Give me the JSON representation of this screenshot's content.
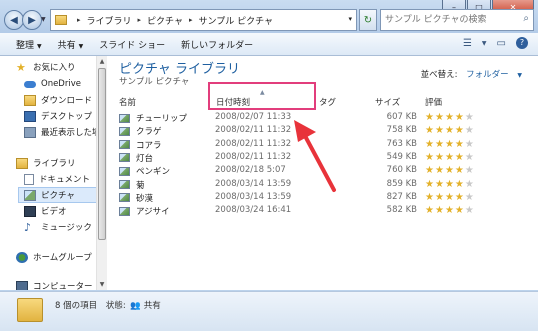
{
  "window": {
    "minimize": "–",
    "maximize": "□",
    "close": "✕"
  },
  "nav_buttons": {
    "back": "◀",
    "forward": "▶",
    "dropdown": "▼"
  },
  "address": {
    "root_arrow": "▸",
    "segments": [
      "ライブラリ",
      "ピクチャ",
      "サンプル ピクチャ"
    ],
    "separator": "▸",
    "dropdown": "▾",
    "refresh": "↻"
  },
  "search": {
    "placeholder": "サンプル ピクチャの検索",
    "icon": "⌕"
  },
  "toolbar": {
    "organize": "整理",
    "share": "共有",
    "slideshow": "スライド ショー",
    "new_folder": "新しいフォルダー",
    "dropdown_arrow": "▼",
    "view_icon": "☰",
    "pane_icon": "▭",
    "help_icon": "?"
  },
  "sidebar": {
    "favorites": "お気に入り",
    "onedrive": "OneDrive",
    "downloads": "ダウンロード",
    "desktop": "デスクトップ",
    "recent": "最近表示した場所",
    "libraries": "ライブラリ",
    "documents": "ドキュメント",
    "pictures": "ピクチャ",
    "videos": "ビデオ",
    "music": "ミュージック",
    "homegroup": "ホームグループ",
    "computer": "コンピューター"
  },
  "scrollbar": {
    "up": "▲",
    "down": "▼"
  },
  "library": {
    "title": "ピクチャ ライブラリ",
    "subtitle": "サンプル ピクチャ",
    "arrange_label": "並べ替え:",
    "arrange_value": "フォルダー",
    "arrange_arrow": "▼"
  },
  "columns": {
    "name": "名前",
    "date": "日付時刻",
    "tag": "タグ",
    "size": "サイズ",
    "rating": "評価",
    "sort_indicator": "▲"
  },
  "files": [
    {
      "name": "チューリップ",
      "date": "2008/02/07 11:33",
      "size": "607 KB",
      "stars": 4
    },
    {
      "name": "クラゲ",
      "date": "2008/02/11 11:32",
      "size": "758 KB",
      "stars": 4
    },
    {
      "name": "コアラ",
      "date": "2008/02/11 11:32",
      "size": "763 KB",
      "stars": 4
    },
    {
      "name": "灯台",
      "date": "2008/02/11 11:32",
      "size": "549 KB",
      "stars": 4
    },
    {
      "name": "ペンギン",
      "date": "2008/02/18 5:07",
      "size": "760 KB",
      "stars": 4
    },
    {
      "name": "菊",
      "date": "2008/03/14 13:59",
      "size": "859 KB",
      "stars": 4
    },
    {
      "name": "砂漠",
      "date": "2008/03/14 13:59",
      "size": "827 KB",
      "stars": 4
    },
    {
      "name": "アジサイ",
      "date": "2008/03/24 16:41",
      "size": "582 KB",
      "stars": 4
    }
  ],
  "star_glyph": "★",
  "details": {
    "count": "8 個の項目",
    "status_label": "状態:",
    "status_value": "共有"
  },
  "colors": {
    "highlight": "#e23d7c",
    "arrow": "#e8333a",
    "title_blue": "#1e5fa0"
  }
}
